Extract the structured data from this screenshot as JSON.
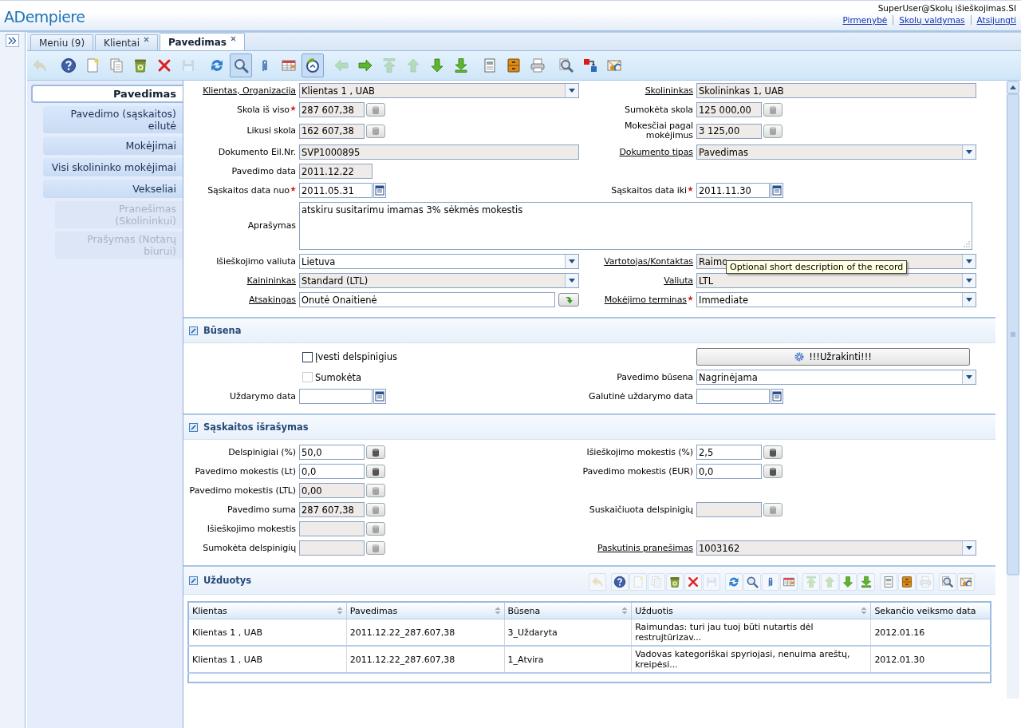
{
  "header": {
    "logo": "ADempiere",
    "user": "SuperUser@Skolų išieškojimas.SI",
    "links": [
      "Pirmenybė",
      "Skolų valdymas",
      "Atsijungti"
    ]
  },
  "tabs": [
    {
      "label": "Meniu (9)",
      "closable": false,
      "selected": false
    },
    {
      "label": "Klientai",
      "closable": true,
      "selected": false
    },
    {
      "label": "Pavedimas",
      "closable": true,
      "selected": true
    }
  ],
  "toolbar": [
    {
      "buttons": [
        {
          "kind": "undo",
          "disabled": true,
          "pressed": false
        }
      ]
    },
    {
      "buttons": [
        {
          "kind": "help",
          "disabled": false,
          "pressed": false
        },
        {
          "kind": "new",
          "disabled": false,
          "pressed": false
        },
        {
          "kind": "copy",
          "disabled": false,
          "pressed": false
        },
        {
          "kind": "trash",
          "disabled": false,
          "pressed": false
        },
        {
          "kind": "delete",
          "disabled": false,
          "pressed": false
        },
        {
          "kind": "save",
          "disabled": true,
          "pressed": false
        }
      ]
    },
    {
      "buttons": [
        {
          "kind": "refresh",
          "disabled": false,
          "pressed": false
        },
        {
          "kind": "find",
          "disabled": false,
          "pressed": true
        },
        {
          "kind": "attach",
          "disabled": false,
          "pressed": false
        },
        {
          "kind": "grid",
          "disabled": false,
          "pressed": false
        },
        {
          "kind": "history",
          "disabled": false,
          "pressed": true
        }
      ]
    },
    {
      "buttons": [
        {
          "kind": "prev",
          "disabled": true,
          "pressed": false
        },
        {
          "kind": "next",
          "disabled": false,
          "pressed": false
        },
        {
          "kind": "first",
          "disabled": true,
          "pressed": false
        },
        {
          "kind": "up",
          "disabled": true,
          "pressed": false
        },
        {
          "kind": "down",
          "disabled": false,
          "pressed": false
        },
        {
          "kind": "last",
          "disabled": false,
          "pressed": false
        }
      ]
    },
    {
      "buttons": [
        {
          "kind": "report",
          "disabled": false,
          "pressed": false
        },
        {
          "kind": "archive",
          "disabled": false,
          "pressed": false
        },
        {
          "kind": "print",
          "disabled": false,
          "pressed": false
        }
      ]
    },
    {
      "buttons": [
        {
          "kind": "zoom",
          "disabled": false,
          "pressed": false
        },
        {
          "kind": "workflow",
          "disabled": false,
          "pressed": false
        },
        {
          "kind": "request",
          "disabled": false,
          "pressed": false
        }
      ]
    }
  ],
  "side_tabs": [
    {
      "label": "Pavedimas",
      "selected": true,
      "disabled": false
    },
    {
      "label": "Pavedimo (sąskaitos) eilutė",
      "selected": false,
      "disabled": false
    },
    {
      "label": "Mokėjimai",
      "selected": false,
      "disabled": false
    },
    {
      "label": "Visi skolininko mokėjimai",
      "selected": false,
      "disabled": false
    },
    {
      "label": "Vekseliai",
      "selected": false,
      "disabled": false,
      "children": [
        {
          "label": "Pranešimas (Skolininkui)",
          "selected": false,
          "disabled": true
        },
        {
          "label": "Prašymas (Notarų biurui)",
          "selected": false,
          "disabled": true
        }
      ]
    }
  ],
  "sections": [
    {
      "rows": [
        {
          "left": {
            "label": "Klientas, Organizacija",
            "link": true,
            "kind": "select",
            "readonly": true,
            "value": "Klientas 1 , UAB"
          },
          "right": {
            "label": "Skolininkas",
            "link": true,
            "kind": "text",
            "readonly": true,
            "value": "Skolininkas 1, UAB"
          }
        },
        {
          "left": {
            "label": "Skola iš viso",
            "required": true,
            "kind": "number",
            "readonly": true,
            "value": "287 607,38"
          },
          "right": {
            "label": "Sumokėta skola",
            "kind": "number",
            "readonly": true,
            "value": "125 000,00"
          }
        },
        {
          "left": {
            "label": "Likusi skola",
            "kind": "number",
            "readonly": true,
            "value": "162 607,38"
          },
          "right": {
            "label": "Mokesčiai pagal mokėjimus",
            "kind": "number",
            "readonly": true,
            "value": "3 125,00"
          }
        },
        {
          "left": {
            "label": "Dokumento Eil.Nr.",
            "kind": "text",
            "readonly": true,
            "value": "SVP1000895"
          },
          "right": {
            "label": "Dokumento tipas",
            "link": true,
            "kind": "select",
            "readonly": true,
            "value": "Pavedimas"
          }
        },
        {
          "left": {
            "label": "Pavedimo data",
            "kind": "date",
            "readonly": true,
            "value": "2011.12.22"
          }
        },
        {
          "left": {
            "label": "Sąskaitos data nuo",
            "required": true,
            "kind": "date",
            "readonly": false,
            "value": "2011.05.31"
          },
          "right": {
            "label": "Sąskaitos data iki",
            "required": true,
            "kind": "date",
            "readonly": false,
            "value": "2011.11.30"
          }
        },
        {
          "left": {
            "label": "Aprašymas",
            "kind": "textarea",
            "readonly": false,
            "value": "atskiru susitarimu imamas 3% sėkmės mokestis"
          }
        },
        {
          "left": {
            "label": "Išieškojimo valiuta",
            "kind": "select",
            "readonly": false,
            "value": "Lietuva"
          },
          "right": {
            "label": "Vartotojas/Kontaktas",
            "link": true,
            "kind": "select",
            "readonly": true,
            "value": "Raimo",
            "tooltip": "Optional short description of the record"
          }
        },
        {
          "left": {
            "label": "Kainininkas",
            "link": true,
            "kind": "select",
            "readonly": true,
            "value": "Standard (LTL)"
          },
          "right": {
            "label": "Valiuta",
            "link": true,
            "kind": "select",
            "readonly": true,
            "value": "LTL"
          }
        },
        {
          "left": {
            "label": "Atsakingas",
            "link": true,
            "kind": "lookup",
            "readonly": false,
            "value": "Onutė Onaitienė"
          },
          "right": {
            "label": "Mokėjimo terminas",
            "link": true,
            "required": true,
            "kind": "select",
            "readonly": false,
            "value": "Immediate"
          }
        }
      ]
    },
    {
      "title": "Būsena",
      "rows": [
        {
          "left": {
            "kind": "checkbox",
            "label": "Įvesti delspinigius",
            "checked": false,
            "disabled": false
          },
          "right": {
            "kind": "button",
            "label": "!!!Užrakinti!!!"
          }
        },
        {
          "left": {
            "kind": "checkbox",
            "label": "Sumokėta",
            "checked": false,
            "disabled": true
          },
          "right": {
            "label": "Pavedimo būsena",
            "kind": "select",
            "readonly": false,
            "value": "Nagrinėjama"
          }
        },
        {
          "left": {
            "label": "Uždarymo data",
            "kind": "date",
            "readonly": false
          },
          "right": {
            "label": "Galutinė uždarymo data",
            "kind": "date",
            "readonly": false
          }
        }
      ]
    },
    {
      "title": "Sąskaitos išrašymas",
      "rows": [
        {
          "left": {
            "label": "Delspinigiai (%)",
            "kind": "number",
            "readonly": false,
            "value": "50,0"
          },
          "right": {
            "label": "Išieškojimo mokestis (%)",
            "kind": "number",
            "readonly": false,
            "value": "2,5"
          }
        },
        {
          "left": {
            "label": "Pavedimo mokestis (Lt)",
            "kind": "number",
            "readonly": false,
            "value": "0,0"
          },
          "right": {
            "label": "Pavedimo mokestis (EUR)",
            "kind": "number",
            "readonly": false,
            "value": "0,0"
          }
        },
        {
          "left": {
            "label": "Pavedimo mokestis (LTL)",
            "kind": "number",
            "readonly": true,
            "value": "0,00"
          }
        },
        {
          "left": {
            "label": "Pavedimo suma",
            "kind": "number",
            "readonly": true,
            "value": "287 607,38"
          },
          "right": {
            "label": "Suskaičiuota delspinigių",
            "kind": "number",
            "readonly": true
          }
        },
        {
          "left": {
            "label": "Išieškojimo mokestis",
            "kind": "number",
            "readonly": true
          }
        },
        {
          "left": {
            "label": "Sumokėta delspinigių",
            "kind": "number",
            "readonly": true
          },
          "right": {
            "label": "Paskutinis pranešimas",
            "link": true,
            "kind": "select",
            "readonly": true,
            "value": "1003162"
          }
        }
      ]
    },
    {
      "title": "Užduotys",
      "toolbar": [
        {
          "buttons": [
            {
              "kind": "undo",
              "disabled": true,
              "pressed": false
            }
          ]
        },
        {
          "buttons": [
            {
              "kind": "help",
              "disabled": false,
              "pressed": false
            },
            {
              "kind": "new",
              "disabled": true,
              "pressed": false
            },
            {
              "kind": "copy",
              "disabled": true,
              "pressed": false
            },
            {
              "kind": "trash",
              "disabled": false,
              "pressed": false
            },
            {
              "kind": "delete",
              "disabled": false,
              "pressed": false
            },
            {
              "kind": "save",
              "disabled": true,
              "pressed": false
            }
          ]
        },
        {
          "buttons": [
            {
              "kind": "refresh",
              "disabled": false,
              "pressed": false
            },
            {
              "kind": "find",
              "disabled": false,
              "pressed": false
            },
            {
              "kind": "attach",
              "disabled": false,
              "pressed": false
            },
            {
              "kind": "grid",
              "disabled": false,
              "pressed": false
            }
          ]
        },
        {
          "buttons": [
            {
              "kind": "first",
              "disabled": true,
              "pressed": false
            },
            {
              "kind": "up",
              "disabled": true,
              "pressed": false
            },
            {
              "kind": "down",
              "disabled": false,
              "pressed": false
            },
            {
              "kind": "last",
              "disabled": false,
              "pressed": false
            }
          ]
        },
        {
          "buttons": [
            {
              "kind": "report",
              "disabled": false,
              "pressed": false
            },
            {
              "kind": "archive",
              "disabled": false,
              "pressed": false
            },
            {
              "kind": "print",
              "disabled": true,
              "pressed": false
            }
          ]
        },
        {
          "buttons": [
            {
              "kind": "zoom",
              "disabled": false,
              "pressed": false
            },
            {
              "kind": "request",
              "disabled": false,
              "pressed": false
            }
          ]
        }
      ],
      "table": {
        "columns": [
          {
            "label": "Klientas",
            "sortable": true
          },
          {
            "label": "Pavedimas",
            "sortable": true
          },
          {
            "label": "Būsena",
            "sortable": true
          },
          {
            "label": "Užduotis",
            "sortable": true
          },
          {
            "label": "Sekančio veiksmo data",
            "sortable": false
          }
        ],
        "rows": [
          [
            "Klientas 1 , UAB",
            "2011.12.22_287.607,38",
            "3_Uždaryta",
            "Raimundas: turi jau tuoj būti nutartis dėl restrujtūrizav...",
            "2012.01.16"
          ],
          [
            "Klientas 1 , UAB",
            "2011.12.22_287.607,38",
            "1_Atvira",
            "Vadovas kategoriškai spyriojasi, nenuima areštų, kreipėsi...",
            "2012.01.30"
          ]
        ]
      }
    }
  ]
}
